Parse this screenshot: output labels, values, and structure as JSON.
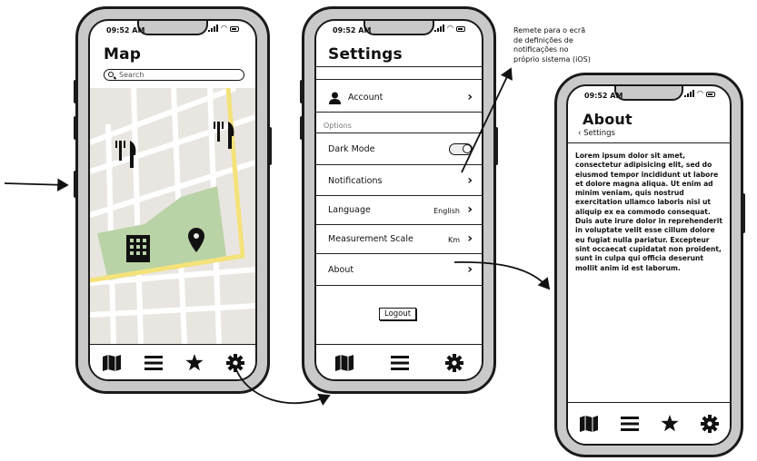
{
  "status": {
    "time": "09:52 AM"
  },
  "map_screen": {
    "title": "Map",
    "search_placeholder": "Search"
  },
  "settings_screen": {
    "title": "Settings",
    "account_label": "Account",
    "options_header": "Options",
    "rows": {
      "dark_mode": "Dark Mode",
      "notifications": "Notifications",
      "language": "Language",
      "language_value": "English",
      "measurement": "Measurement Scale",
      "measurement_value": "Km",
      "about": "About"
    },
    "logout_label": "Logout"
  },
  "about_screen": {
    "title": "About",
    "back_label": "Settings",
    "body": "Lorem ipsum dolor sit amet, consectetur adipisicing elit, sed do eiusmod tempor incididunt ut labore et dolore magna aliqua. Ut enim ad minim veniam, quis nostrud exercitation ullamco laboris nisi ut aliquip ex ea commodo consequat. Duis aute irure dolor in reprehenderit in voluptate velit esse cillum dolore eu fugiat nulla pariatur. Excepteur sint occaecat cupidatat non proident, sunt in culpa qui officia deserunt mollit anim id est laborum."
  },
  "annotation": {
    "note": "Remete para o ecrã de definições de notificações no próprio sistema (iOS)"
  },
  "tabs": {
    "map_icon": "map-icon",
    "list_icon": "list-icon",
    "star_icon": "star-icon",
    "gear_icon": "gear-icon"
  },
  "colors": {
    "phone_frame": "#c9c9c9",
    "map_background": "#e9e6e1",
    "park_green": "#b9d3a6",
    "main_road_yellow": "#f4e27a"
  }
}
